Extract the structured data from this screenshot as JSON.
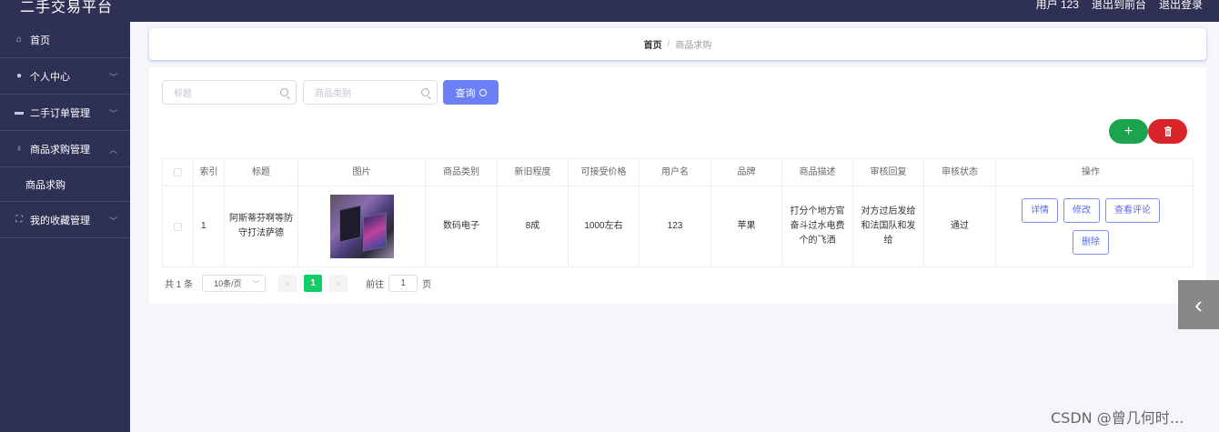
{
  "app": {
    "title": "二手交易平台"
  },
  "topbar": {
    "user": "用户 123",
    "back_front": "退出到前台",
    "logout": "退出登录"
  },
  "sidebar": {
    "items": [
      {
        "label": "首页",
        "icon": "home-icon"
      },
      {
        "label": "个人中心",
        "icon": "user-icon"
      },
      {
        "label": "二手订单管理",
        "icon": "document-icon"
      },
      {
        "label": "商品求购管理",
        "icon": "microphone-icon"
      },
      {
        "label": "我的收藏管理",
        "icon": "bookmark-icon"
      }
    ],
    "submenu": {
      "label": "商品求购"
    }
  },
  "breadcrumb": {
    "home": "首页",
    "separator": "/",
    "current": "商品求购"
  },
  "search": {
    "title_placeholder": "标题",
    "category_placeholder": "商品类别",
    "query_label": "查询"
  },
  "actions": {
    "add_label": "+",
    "delete_icon": "trash-icon"
  },
  "table": {
    "headers": [
      "索引",
      "标题",
      "图片",
      "商品类别",
      "新旧程度",
      "可接受价格",
      "用户名",
      "品牌",
      "商品描述",
      "审核回复",
      "审核状态",
      "操作"
    ],
    "rows": [
      {
        "index": "1",
        "title": "阿斯蒂芬啊等防守打法萨德",
        "category": "数码电子",
        "condition": "8成",
        "price": "1000左右",
        "username": "123",
        "brand": "苹果",
        "description": "打分个地方官奋斗过水电费个的飞洒",
        "reply": "对方过后发给和法国队和发给",
        "status": "通过",
        "ops": {
          "detail": "详情",
          "edit": "修改",
          "view_comments": "查看评论",
          "delete": "删除"
        }
      }
    ]
  },
  "pagination": {
    "total": "共 1 条",
    "page_size": "10条/页",
    "current_page": "1",
    "goto_label": "前往",
    "goto_value": "1",
    "page_suffix": "页"
  },
  "watermark": "CSDN @曾几何时…"
}
